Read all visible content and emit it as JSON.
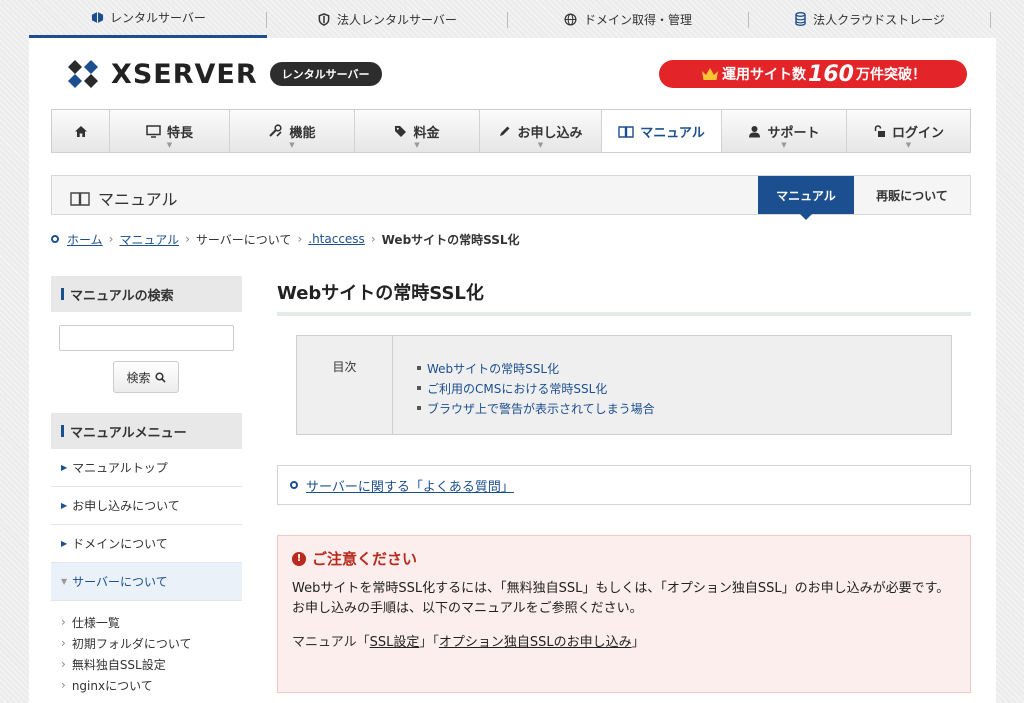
{
  "top_tabs": [
    {
      "label": "レンタルサーバー",
      "icon": "cube-icon"
    },
    {
      "label": "法人レンタルサーバー",
      "icon": "shield-icon"
    },
    {
      "label": "ドメイン取得・管理",
      "icon": "globe-icon"
    },
    {
      "label": "法人クラウドストレージ",
      "icon": "database-icon"
    }
  ],
  "logo": {
    "word": "XSERVER",
    "badge": "レンタルサーバー"
  },
  "promo": {
    "prefix": "運用サイト数",
    "number": "160",
    "suffix": "万件突破！"
  },
  "global_nav": [
    {
      "label": ""
    },
    {
      "label": "特長"
    },
    {
      "label": "機能"
    },
    {
      "label": "料金"
    },
    {
      "label": "お申し込み"
    },
    {
      "label": "マニュアル"
    },
    {
      "label": "サポート"
    },
    {
      "label": "ログイン"
    }
  ],
  "section": {
    "title": "マニュアル",
    "tab_manual": "マニュアル",
    "tab_resale": "再販について"
  },
  "breadcrumb": {
    "items": [
      "ホーム",
      "マニュアル",
      "サーバーについて",
      ".htaccess"
    ],
    "current": "Webサイトの常時SSL化"
  },
  "sidebar": {
    "search_heading": "マニュアルの検索",
    "search_button": "検索",
    "menu_heading": "マニュアルメニュー",
    "items": [
      "マニュアルトップ",
      "お申し込みについて",
      "ドメインについて",
      "サーバーについて"
    ],
    "sub_items": [
      "仕様一覧",
      "初期フォルダについて",
      "無料独自SSL設定",
      "nginxについて"
    ]
  },
  "content": {
    "title": "Webサイトの常時SSL化",
    "toc_label": "目次",
    "toc_items": [
      "Webサイトの常時SSL化",
      "ご利用のCMSにおける常時SSL化",
      "ブラウザ上で警告が表示されてしまう場合"
    ],
    "faq_link": "サーバーに関する「よくある質問」",
    "notice": {
      "heading": "ご注意ください",
      "line1": "Webサイトを常時SSL化するには、「無料独自SSL」もしくは、「オプション独自SSL」のお申し込みが必要です。",
      "line2": "お申し込みの手順は、以下のマニュアルをご参照ください。",
      "links_prefix": "マニュアル「",
      "link1": "SSL設定",
      "link_mid": "」「",
      "link2": "オプション独自SSLのお申し込み",
      "links_suffix": "」"
    }
  },
  "colors": {
    "brand_blue": "#1c4f8f",
    "promo_red": "#e3252a",
    "notice_red": "#b8291e"
  }
}
